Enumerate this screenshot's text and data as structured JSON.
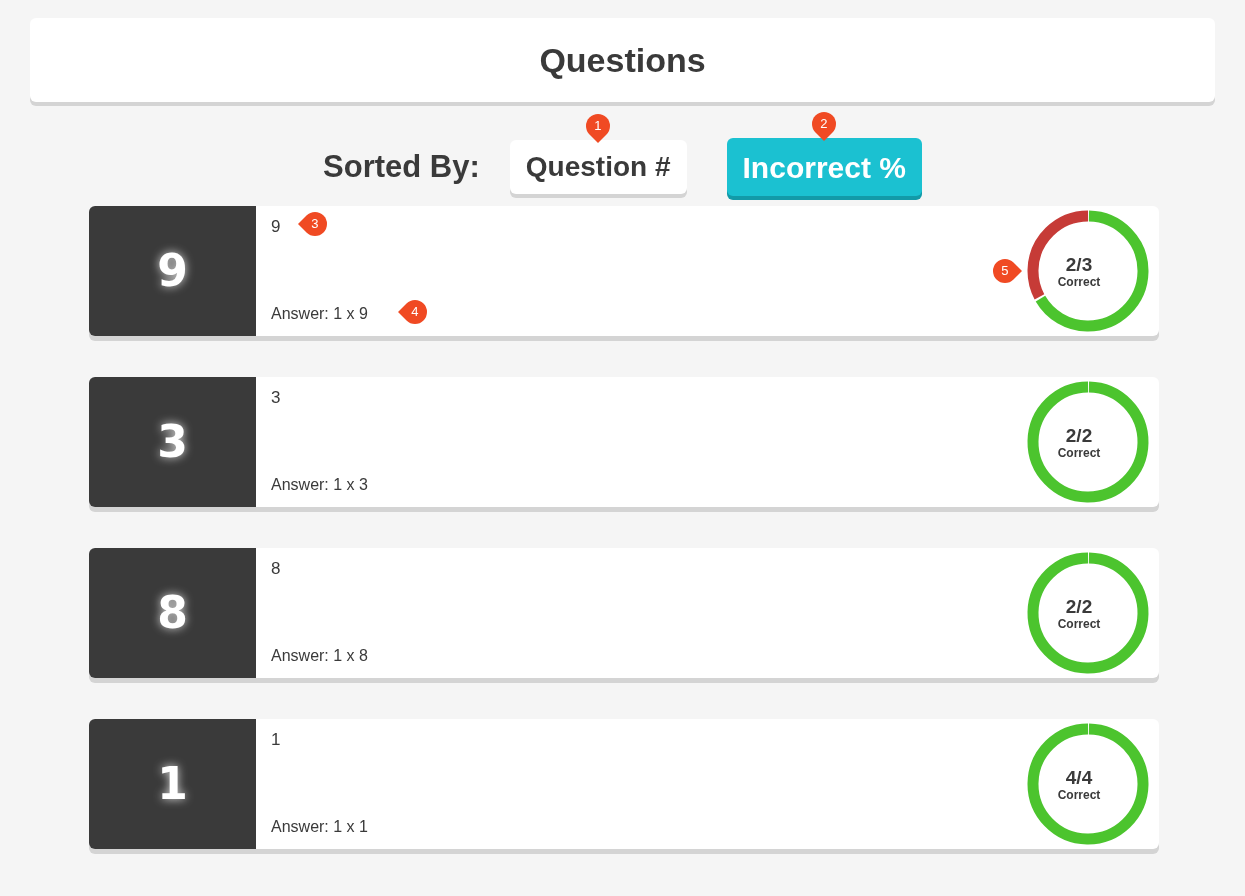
{
  "header": {
    "title": "Questions"
  },
  "sort": {
    "label": "Sorted By:",
    "options": [
      {
        "label": "Question #",
        "selected": false,
        "callout": "1"
      },
      {
        "label": "Incorrect %",
        "selected": true,
        "callout": "2"
      }
    ]
  },
  "questions": [
    {
      "number": "9",
      "text": "9",
      "answer": "Answer: 1 x 9",
      "score": "2/3",
      "score_label": "Correct",
      "level": 0.6667,
      "text_callout": "3",
      "answer_callout": "4",
      "chart_callout": "5"
    },
    {
      "number": "3",
      "text": "3",
      "answer": "Answer: 1 x 3",
      "score": "2/2",
      "score_label": "Correct",
      "level": 1
    },
    {
      "number": "8",
      "text": "8",
      "answer": "Answer: 1 x 8",
      "score": "2/2",
      "score_label": "Correct",
      "level": 1
    },
    {
      "number": "1",
      "text": "1",
      "answer": "Answer: 1 x 1",
      "score": "4/4",
      "score_label": "Correct",
      "level": 1
    }
  ]
}
